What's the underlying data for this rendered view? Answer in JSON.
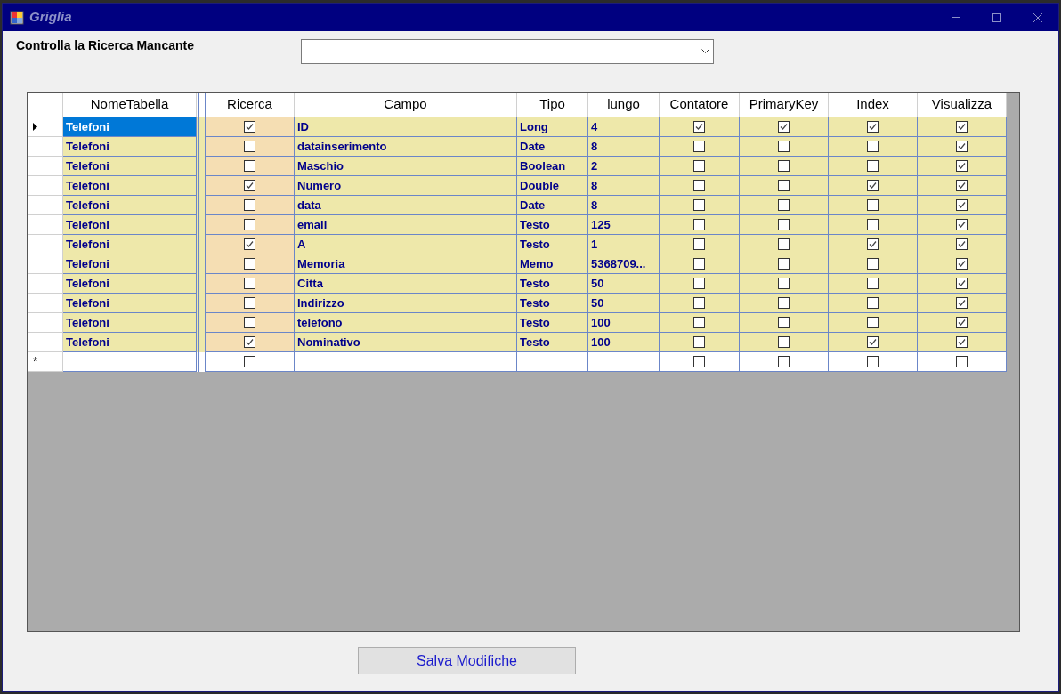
{
  "window": {
    "title": "Griglia"
  },
  "filter": {
    "label": "Controlla la Ricerca Mancante"
  },
  "table": {
    "columns": [
      {
        "label": "NomeTabella",
        "kind": "text"
      },
      {
        "label": "Ricerca",
        "kind": "check"
      },
      {
        "label": "Campo",
        "kind": "text"
      },
      {
        "label": "Tipo",
        "kind": "text"
      },
      {
        "label": "lungo",
        "kind": "text"
      },
      {
        "label": "Contatore",
        "kind": "check"
      },
      {
        "label": "PrimaryKey",
        "kind": "check"
      },
      {
        "label": "Index",
        "kind": "check"
      },
      {
        "label": "Visualizza",
        "kind": "check"
      }
    ],
    "rows": [
      {
        "selected": true,
        "cells": [
          "Telefoni",
          true,
          "ID",
          "Long",
          "4",
          true,
          true,
          true,
          true
        ]
      },
      {
        "selected": false,
        "cells": [
          "Telefoni",
          false,
          "datainserimento",
          "Date",
          "8",
          false,
          false,
          false,
          true
        ]
      },
      {
        "selected": false,
        "cells": [
          "Telefoni",
          false,
          "Maschio",
          "Boolean",
          "2",
          false,
          false,
          false,
          true
        ]
      },
      {
        "selected": false,
        "cells": [
          "Telefoni",
          true,
          "Numero",
          "Double",
          "8",
          false,
          false,
          true,
          true
        ]
      },
      {
        "selected": false,
        "cells": [
          "Telefoni",
          false,
          "data",
          "Date",
          "8",
          false,
          false,
          false,
          true
        ]
      },
      {
        "selected": false,
        "cells": [
          "Telefoni",
          false,
          "email",
          "Testo",
          "125",
          false,
          false,
          false,
          true
        ]
      },
      {
        "selected": false,
        "cells": [
          "Telefoni",
          true,
          "A",
          "Testo",
          "1",
          false,
          false,
          true,
          true
        ]
      },
      {
        "selected": false,
        "cells": [
          "Telefoni",
          false,
          "Memoria",
          "Memo",
          "5368709...",
          false,
          false,
          false,
          true
        ]
      },
      {
        "selected": false,
        "cells": [
          "Telefoni",
          false,
          "Citta",
          "Testo",
          "50",
          false,
          false,
          false,
          true
        ]
      },
      {
        "selected": false,
        "cells": [
          "Telefoni",
          false,
          "Indirizzo",
          "Testo",
          "50",
          false,
          false,
          false,
          true
        ]
      },
      {
        "selected": false,
        "cells": [
          "Telefoni",
          false,
          "telefono",
          "Testo",
          "100",
          false,
          false,
          false,
          true
        ]
      },
      {
        "selected": false,
        "cells": [
          "Telefoni",
          true,
          "Nominativo",
          "Testo",
          "100",
          false,
          false,
          true,
          true
        ]
      }
    ],
    "new_row": {
      "marker": "*",
      "cells": [
        "",
        false,
        "",
        "",
        "",
        false,
        false,
        false,
        false
      ]
    }
  },
  "buttons": [
    "Salva Modifiche"
  ]
}
